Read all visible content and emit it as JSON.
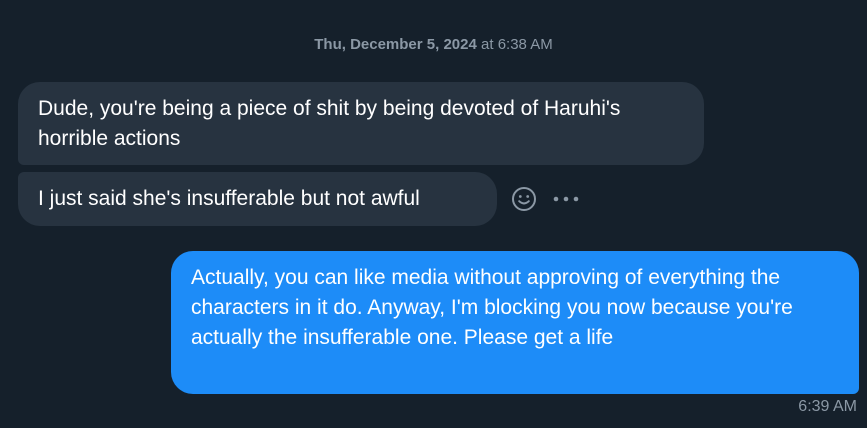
{
  "thread": {
    "date_label": "Thu, December 5, 2024",
    "time_joiner": "at",
    "time_label": "6:38 AM"
  },
  "messages": [
    {
      "direction": "incoming",
      "text": "Dude, you're being a piece of shit by being devoted of Haruhi's horrible actions"
    },
    {
      "direction": "incoming",
      "text": "I just said she's insufferable but not awful"
    },
    {
      "direction": "outgoing",
      "text": "Actually, you can like media without approving of everything the characters in it do. Anyway, I'm blocking you now because you're actually the insufferable one. Please get a life",
      "timestamp": "6:39 AM"
    }
  ],
  "message_actions": {
    "react_icon": "smiley-face-icon",
    "more_icon": "more-horizontal-icon"
  },
  "colors": {
    "background": "#15202b",
    "incoming_bubble": "#273340",
    "outgoing_bubble": "#1d8cf8",
    "muted_text": "#8b98a5",
    "text": "#ffffff"
  }
}
